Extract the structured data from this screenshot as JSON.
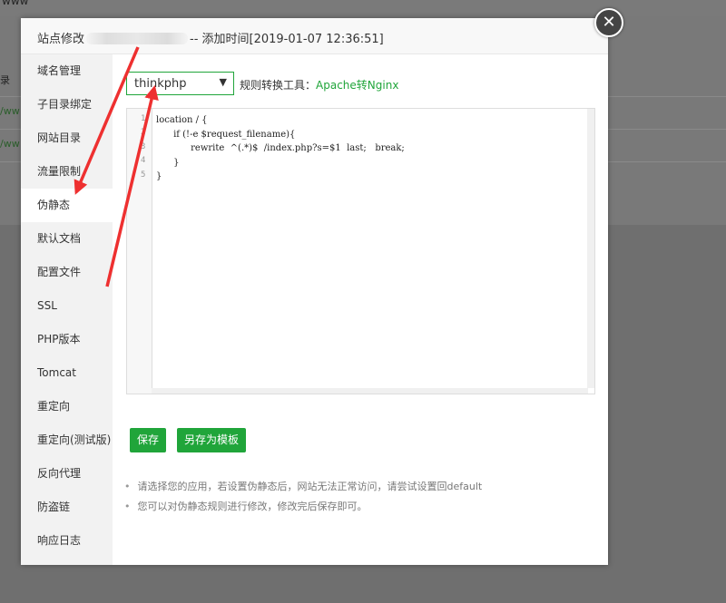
{
  "background": {
    "top_text": "www",
    "rows": [
      {
        "text": "录",
        "dark": true
      },
      {
        "text": "/ww",
        "dark": false
      },
      {
        "text": "/ww",
        "dark": false
      }
    ]
  },
  "modal": {
    "title_prefix": "站点修改",
    "title_suffix": "-- 添加时间[2019-01-07 12:36:51]",
    "close_glyph": "✕"
  },
  "sidebar": {
    "items": [
      {
        "label": "域名管理",
        "active": false
      },
      {
        "label": "子目录绑定",
        "active": false
      },
      {
        "label": "网站目录",
        "active": false
      },
      {
        "label": "流量限制",
        "active": false
      },
      {
        "label": "伪静态",
        "active": true
      },
      {
        "label": "默认文档",
        "active": false
      },
      {
        "label": "配置文件",
        "active": false
      },
      {
        "label": "SSL",
        "active": false
      },
      {
        "label": "PHP版本",
        "active": false
      },
      {
        "label": "Tomcat",
        "active": false
      },
      {
        "label": "重定向",
        "active": false
      },
      {
        "label": "重定向(测试版)",
        "active": false
      },
      {
        "label": "反向代理",
        "active": false
      },
      {
        "label": "防盗链",
        "active": false
      },
      {
        "label": "响应日志",
        "active": false
      }
    ]
  },
  "rewrite": {
    "selected": "thinkphp",
    "tool_label": "规则转换工具：",
    "tool_link": "Apache转Nginx",
    "line_numbers": [
      "1",
      "2",
      "3",
      "4",
      "5"
    ],
    "code": "location / {\n      if (!-e $request_filename){\n            rewrite  ^(.*)$  /index.php?s=$1  last;   break;\n      }\n}",
    "save_label": "保存",
    "save_template_label": "另存为模板",
    "tips": [
      "请选择您的应用，若设置伪静态后，网站无法正常访问，请尝试设置回default",
      "您可以对伪静态规则进行修改，修改完后保存即可。"
    ]
  },
  "colors": {
    "accent": "#20a53a",
    "annotation": "#ee3030"
  }
}
